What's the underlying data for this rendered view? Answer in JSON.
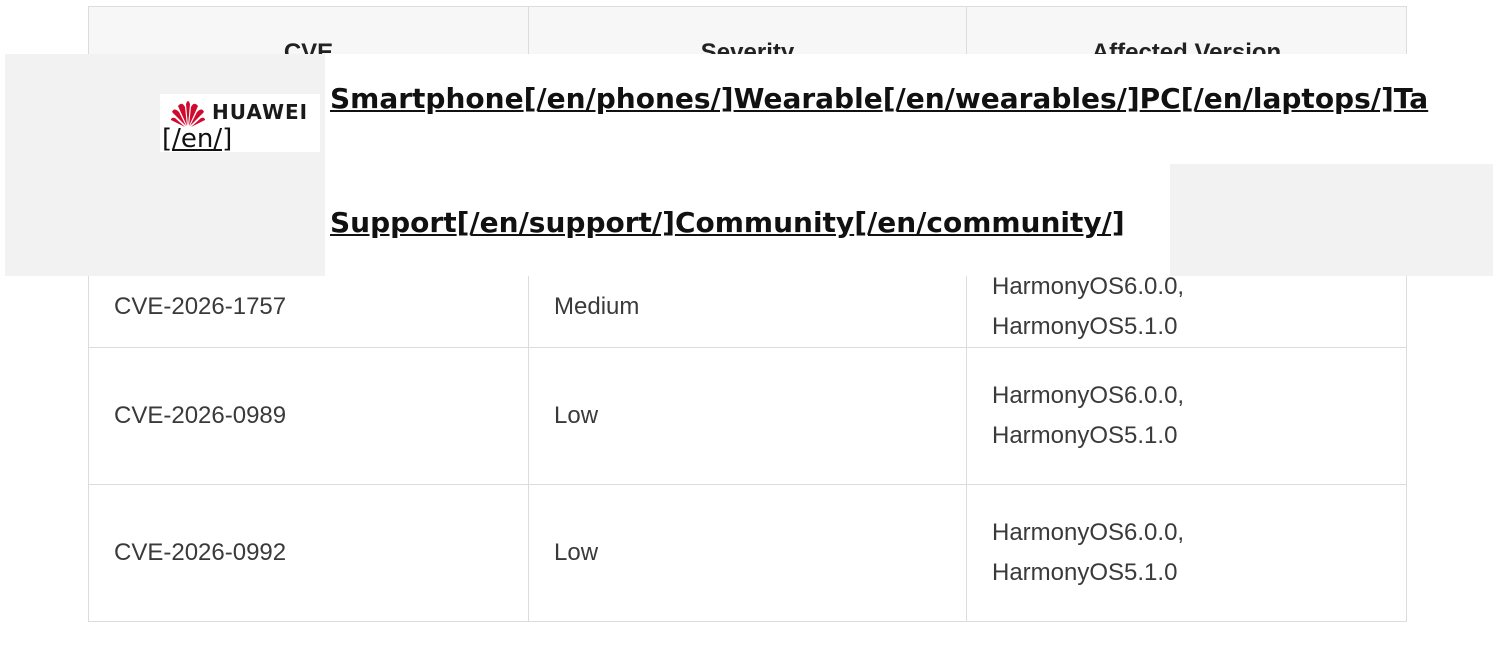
{
  "table": {
    "headers": [
      "CVE",
      "Severity",
      "Affected Version"
    ],
    "rows": [
      {
        "cve": "CVE-2026-1757",
        "severity": "Medium",
        "versions": [
          "HarmonyOS6.0.0,",
          "HarmonyOS5.1.0"
        ]
      },
      {
        "cve": "CVE-2026-0989",
        "severity": "Low",
        "versions": [
          "HarmonyOS6.0.0,",
          "HarmonyOS5.1.0"
        ]
      },
      {
        "cve": "CVE-2026-0992",
        "severity": "Low",
        "versions": [
          "HarmonyOS6.0.0,",
          "HarmonyOS5.1.0"
        ]
      }
    ]
  },
  "nav": {
    "logo_text": "HUAWEI",
    "logo_href_text": "[/en/]",
    "line1": [
      {
        "label": "Smartphone",
        "href_text": "[/en/phones/]"
      },
      {
        "label": "Wearable",
        "href_text": "[/en/wearables/]"
      },
      {
        "label": "PC",
        "href_text": "[/en/laptops/]"
      },
      {
        "label": "Ta",
        "href_text": ""
      }
    ],
    "line2": [
      {
        "label": "Support",
        "href_text": "[/en/support/]"
      },
      {
        "label": "Community",
        "href_text": "[/en/community/]"
      }
    ]
  },
  "colors": {
    "brand_red": "#cf0a2c",
    "border": "#dcdcdc",
    "header_bg": "#f7f7f7",
    "overlay_gray": "#f2f2f2"
  }
}
